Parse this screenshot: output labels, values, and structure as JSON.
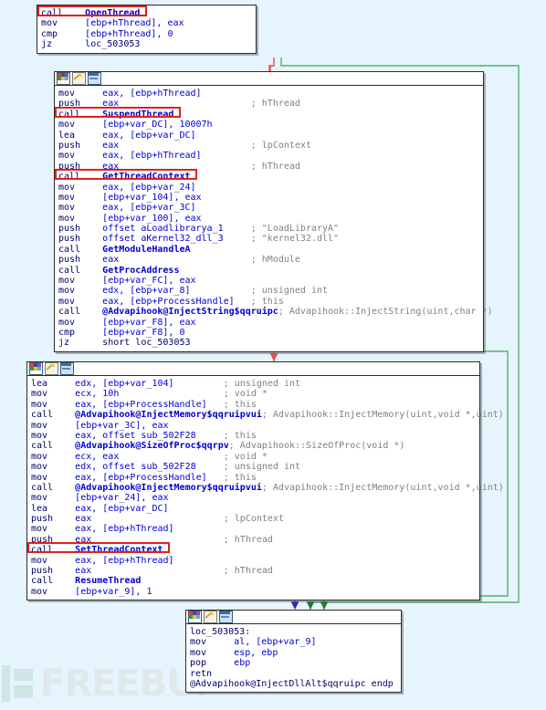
{
  "app": {
    "name": "IDA Pro graph view",
    "background_color": "#e6f4fd",
    "node_fill": "#ffffff",
    "edge_colors": {
      "true_branch": "#35a04a",
      "false_branch": "#e85050",
      "fallthrough": "#4040c0"
    },
    "highlight_color": "#e02020"
  },
  "watermark": {
    "text": "FREEBUF",
    "color": "#dfe9ea"
  },
  "node_title_icons": [
    "color-grid-icon",
    "pencil-edit-icon",
    "window-icon"
  ],
  "nodes": [
    {
      "id": "node-entry",
      "name": "entry-block",
      "lines": [
        {
          "mnemonic": "call",
          "operands": "OpenThread",
          "operand_class": "fn",
          "comment": "",
          "highlight": true
        },
        {
          "mnemonic": "mov",
          "operands": "[ebp+hThread], eax",
          "operand_class": "op",
          "comment": "",
          "highlight": false
        },
        {
          "mnemonic": "cmp",
          "operands": "[ebp+hThread], 0",
          "operand_class": "op",
          "comment": "",
          "highlight": false
        },
        {
          "mnemonic": "jz",
          "operands": "loc_503053",
          "operand_class": "lbl",
          "comment": "",
          "highlight": false
        }
      ]
    },
    {
      "id": "node-suspend",
      "name": "suspend-and-getcontext-block",
      "lines": [
        {
          "mnemonic": "mov",
          "operands": "eax, [ebp+hThread]",
          "operand_class": "op",
          "comment": "",
          "highlight": false
        },
        {
          "mnemonic": "push",
          "operands": "eax",
          "operand_class": "op",
          "comment": "; hThread",
          "highlight": false
        },
        {
          "mnemonic": "call",
          "operands": "SuspendThread",
          "operand_class": "fn",
          "comment": "",
          "highlight": true
        },
        {
          "mnemonic": "mov",
          "operands": "[ebp+var_DC], 10007h",
          "operand_class": "op",
          "comment": "",
          "highlight": false
        },
        {
          "mnemonic": "lea",
          "operands": "eax, [ebp+var_DC]",
          "operand_class": "op",
          "comment": "",
          "highlight": false
        },
        {
          "mnemonic": "push",
          "operands": "eax",
          "operand_class": "op",
          "comment": "; lpContext",
          "highlight": false
        },
        {
          "mnemonic": "mov",
          "operands": "eax, [ebp+hThread]",
          "operand_class": "op",
          "comment": "",
          "highlight": false
        },
        {
          "mnemonic": "push",
          "operands": "eax",
          "operand_class": "op",
          "comment": "; hThread",
          "highlight": false
        },
        {
          "mnemonic": "call",
          "operands": "GetThreadContext",
          "operand_class": "fn",
          "comment": "",
          "highlight": true
        },
        {
          "mnemonic": "mov",
          "operands": "eax, [ebp+var_24]",
          "operand_class": "op",
          "comment": "",
          "highlight": false
        },
        {
          "mnemonic": "mov",
          "operands": "[ebp+var_104], eax",
          "operand_class": "op",
          "comment": "",
          "highlight": false
        },
        {
          "mnemonic": "mov",
          "operands": "eax, [ebp+var_3C]",
          "operand_class": "op",
          "comment": "",
          "highlight": false
        },
        {
          "mnemonic": "mov",
          "operands": "[ebp+var_100], eax",
          "operand_class": "op",
          "comment": "",
          "highlight": false
        },
        {
          "mnemonic": "push",
          "operands": "offset aLoadlibrarya_1",
          "operand_class": "op",
          "comment": "; \"LoadLibraryA\"",
          "highlight": false
        },
        {
          "mnemonic": "push",
          "operands": "offset aKernel32_dll_3",
          "operand_class": "op",
          "comment": "; \"kernel32.dll\"",
          "highlight": false
        },
        {
          "mnemonic": "call",
          "operands": "GetModuleHandleA",
          "operand_class": "fn",
          "comment": "",
          "highlight": false
        },
        {
          "mnemonic": "push",
          "operands": "eax",
          "operand_class": "op",
          "comment": "; hModule",
          "highlight": false
        },
        {
          "mnemonic": "call",
          "operands": "GetProcAddress",
          "operand_class": "fn",
          "comment": "",
          "highlight": false
        },
        {
          "mnemonic": "mov",
          "operands": "[ebp+var_FC], eax",
          "operand_class": "op",
          "comment": "",
          "highlight": false
        },
        {
          "mnemonic": "mov",
          "operands": "edx, [ebp+var_8]",
          "operand_class": "op",
          "comment": "; unsigned int",
          "highlight": false
        },
        {
          "mnemonic": "mov",
          "operands": "eax, [ebp+ProcessHandle]",
          "operand_class": "op",
          "comment": "; this",
          "highlight": false
        },
        {
          "mnemonic": "call",
          "operands": "@Advapihook@InjectString$qqruipc",
          "operand_class": "fn",
          "comment": "; Advapihook::InjectString(uint,char *)",
          "highlight": false
        },
        {
          "mnemonic": "mov",
          "operands": "[ebp+var_F8], eax",
          "operand_class": "op",
          "comment": "",
          "highlight": false
        },
        {
          "mnemonic": "cmp",
          "operands": "[ebp+var_F8], 0",
          "operand_class": "op",
          "comment": "",
          "highlight": false
        },
        {
          "mnemonic": "jz",
          "operands": "short loc_503053",
          "operand_class": "lbl",
          "comment": "",
          "highlight": false
        }
      ]
    },
    {
      "id": "node-inject",
      "name": "inject-memory-and-setcontext-block",
      "lines": [
        {
          "mnemonic": "lea",
          "operands": "edx, [ebp+var_104]",
          "operand_class": "op",
          "comment": "; unsigned int",
          "highlight": false
        },
        {
          "mnemonic": "mov",
          "operands": "ecx, 10h",
          "operand_class": "op",
          "comment": "; void *",
          "highlight": false
        },
        {
          "mnemonic": "mov",
          "operands": "eax, [ebp+ProcessHandle]",
          "operand_class": "op",
          "comment": "; this",
          "highlight": false
        },
        {
          "mnemonic": "call",
          "operands": "@Advapihook@InjectMemory$qqruipvui",
          "operand_class": "fn",
          "comment": "; Advapihook::InjectMemory(uint,void *,uint)",
          "highlight": false
        },
        {
          "mnemonic": "mov",
          "operands": "[ebp+var_3C], eax",
          "operand_class": "op",
          "comment": "",
          "highlight": false
        },
        {
          "mnemonic": "mov",
          "operands": "eax, offset sub_502F28",
          "operand_class": "op",
          "comment": "; this",
          "highlight": false
        },
        {
          "mnemonic": "call",
          "operands": "@Advapihook@SizeOfProc$qqrpv",
          "operand_class": "fn",
          "comment": "; Advapihook::SizeOfProc(void *)",
          "highlight": false
        },
        {
          "mnemonic": "mov",
          "operands": "ecx, eax",
          "operand_class": "op",
          "comment": "; void *",
          "highlight": false
        },
        {
          "mnemonic": "mov",
          "operands": "edx, offset sub_502F28",
          "operand_class": "op",
          "comment": "; unsigned int",
          "highlight": false
        },
        {
          "mnemonic": "mov",
          "operands": "eax, [ebp+ProcessHandle]",
          "operand_class": "op",
          "comment": "; this",
          "highlight": false
        },
        {
          "mnemonic": "call",
          "operands": "@Advapihook@InjectMemory$qqruipvui",
          "operand_class": "fn",
          "comment": "; Advapihook::InjectMemory(uint,void *,uint)",
          "highlight": false
        },
        {
          "mnemonic": "mov",
          "operands": "[ebp+var_24], eax",
          "operand_class": "op",
          "comment": "",
          "highlight": false
        },
        {
          "mnemonic": "lea",
          "operands": "eax, [ebp+var_DC]",
          "operand_class": "op",
          "comment": "",
          "highlight": false
        },
        {
          "mnemonic": "push",
          "operands": "eax",
          "operand_class": "op",
          "comment": "; lpContext",
          "highlight": false
        },
        {
          "mnemonic": "mov",
          "operands": "eax, [ebp+hThread]",
          "operand_class": "op",
          "comment": "",
          "highlight": false
        },
        {
          "mnemonic": "push",
          "operands": "eax",
          "operand_class": "op",
          "comment": "; hThread",
          "highlight": false
        },
        {
          "mnemonic": "call",
          "operands": "SetThreadContext",
          "operand_class": "fn",
          "comment": "",
          "highlight": true
        },
        {
          "mnemonic": "mov",
          "operands": "eax, [ebp+hThread]",
          "operand_class": "op",
          "comment": "",
          "highlight": false
        },
        {
          "mnemonic": "push",
          "operands": "eax",
          "operand_class": "op",
          "comment": "; hThread",
          "highlight": false
        },
        {
          "mnemonic": "call",
          "operands": "ResumeThread",
          "operand_class": "fn",
          "comment": "",
          "highlight": false
        },
        {
          "mnemonic": "mov",
          "operands": "[ebp+var_9], 1",
          "operand_class": "op",
          "comment": "",
          "highlight": false
        }
      ]
    },
    {
      "id": "node-exit",
      "name": "exit-block",
      "lines": [
        {
          "mnemonic": "",
          "operands": "loc_503053:",
          "operand_class": "lbl",
          "comment": "",
          "highlight": false
        },
        {
          "mnemonic": "mov",
          "operands": "al, [ebp+var_9]",
          "operand_class": "op",
          "comment": "",
          "highlight": false
        },
        {
          "mnemonic": "mov",
          "operands": "esp, ebp",
          "operand_class": "op",
          "comment": "",
          "highlight": false
        },
        {
          "mnemonic": "pop",
          "operands": "ebp",
          "operand_class": "op",
          "comment": "",
          "highlight": false
        },
        {
          "mnemonic": "retn",
          "operands": "",
          "operand_class": "op",
          "comment": "",
          "highlight": false
        },
        {
          "mnemonic": "",
          "operands": "@Advapihook@InjectDllAlt$qqruipc endp",
          "operand_class": "lbl",
          "comment": "",
          "highlight": false
        }
      ]
    }
  ]
}
